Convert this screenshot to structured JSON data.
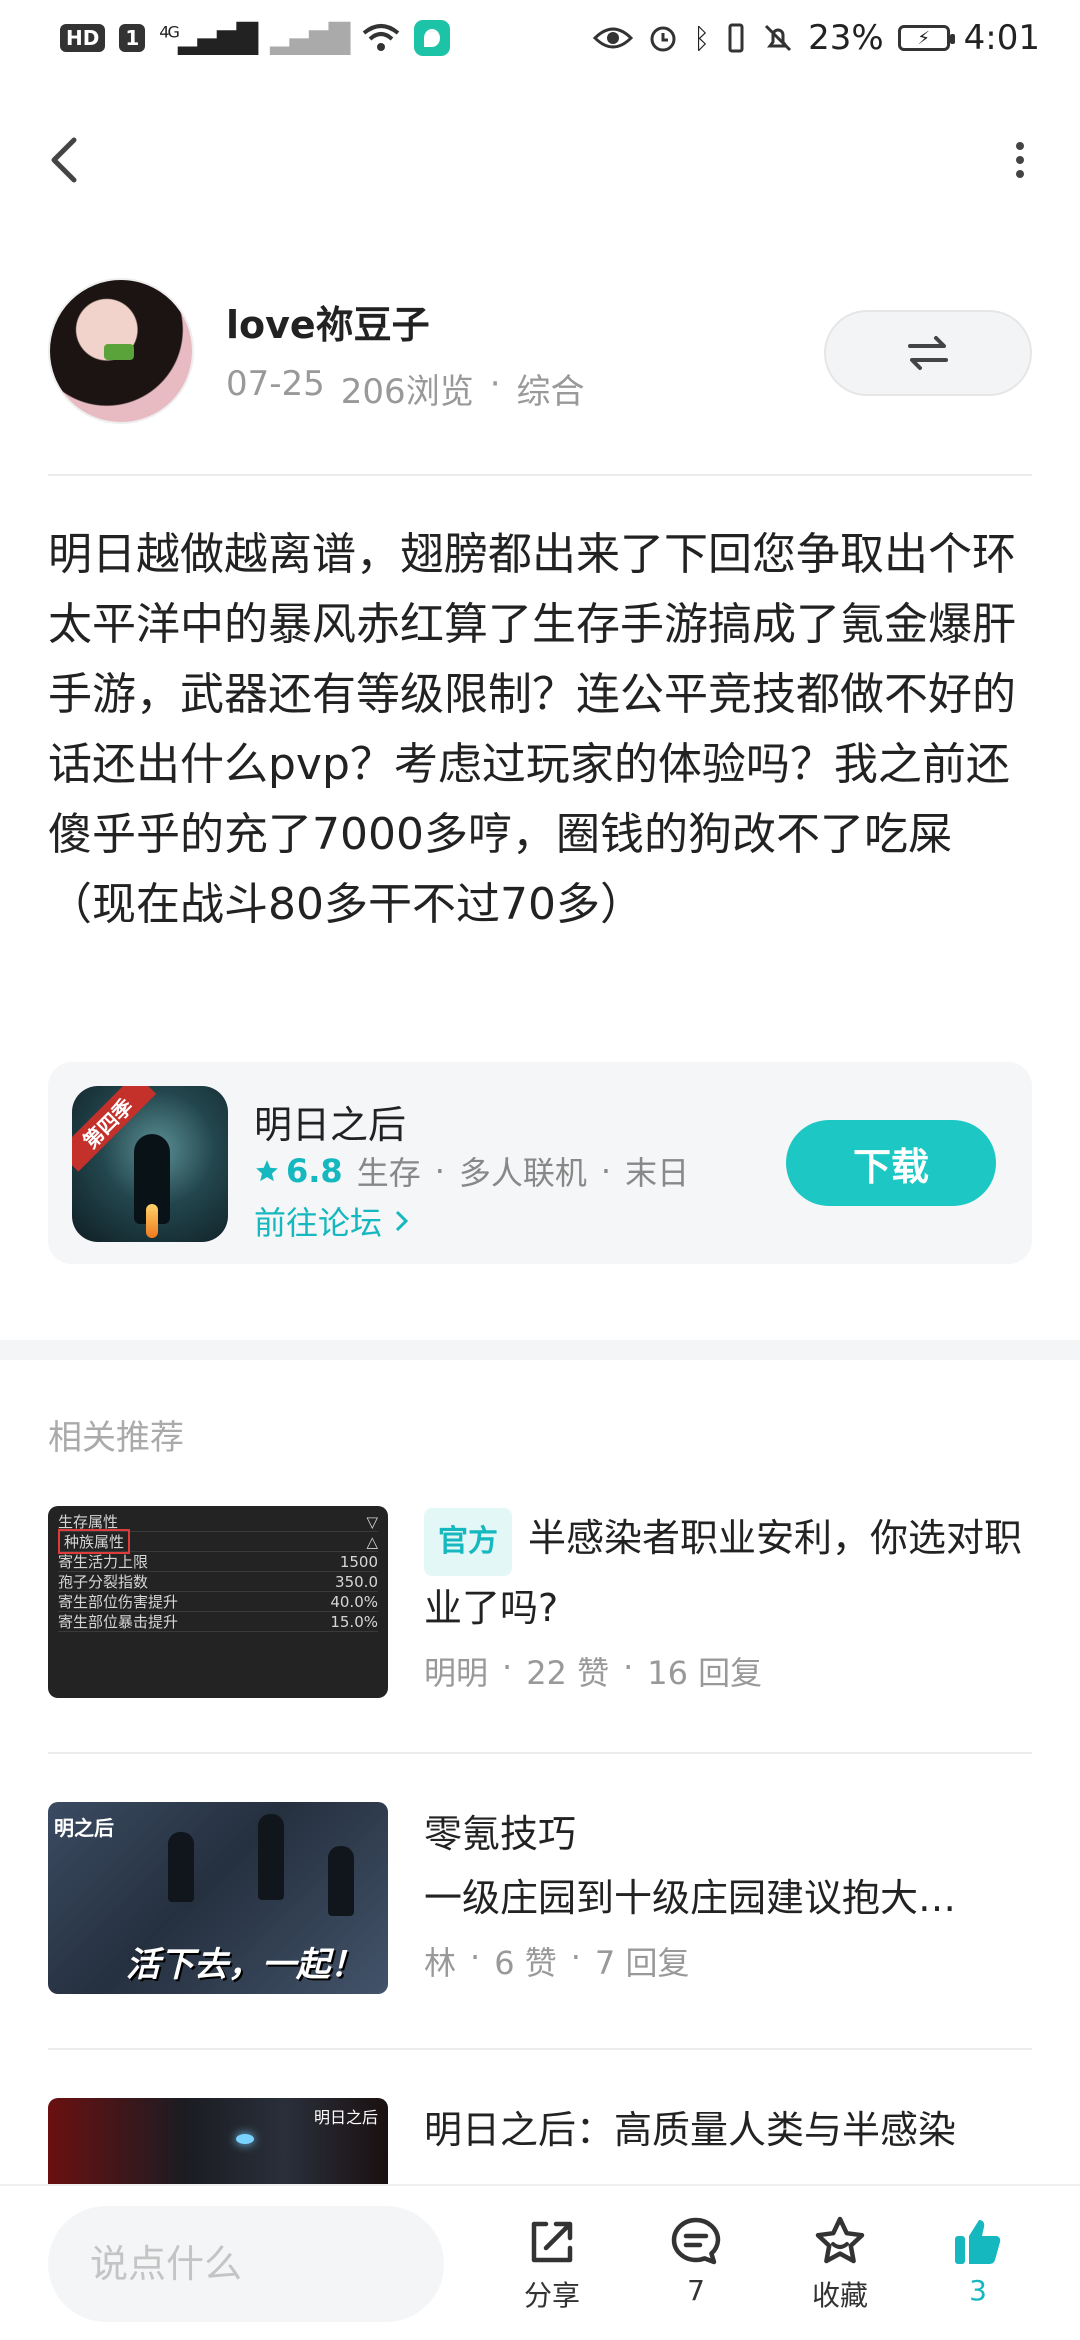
{
  "status_bar": {
    "left_badges": [
      "HD",
      "1",
      "4G"
    ],
    "battery_percent": "23%",
    "time": "4:01"
  },
  "author": {
    "name": "love祢豆子",
    "date": "07-25",
    "views": "206浏览",
    "separator": "·",
    "category": "综合"
  },
  "post": {
    "content": "明日越做越离谱，翅膀都出来了下回您争取出个环太平洋中的暴风赤红算了生存手游搞成了氪金爆肝手游，武器还有等级限制？连公平竞技都做不好的话还出什么pvp？考虑过玩家的体验吗？我之前还傻乎乎的充了7000多哼，圈钱的狗改不了吃屎（现在战斗80多干不过70多）"
  },
  "game_card": {
    "season_badge": "第四季",
    "title": "明日之后",
    "rating": "6.8",
    "tags": [
      "生存",
      "多人联机",
      "末日"
    ],
    "forum_link": "前往论坛",
    "download_label": "下载",
    "accent_color": "#1cc7c4"
  },
  "related": {
    "section_title": "相关推荐",
    "items": [
      {
        "badge": "官方",
        "title": "半感染者职业安利，你选对职业了吗?",
        "subtitle": "",
        "author": "明明",
        "likes": "22 赞",
        "replies": "16 回复",
        "thumb": {
          "header": "生存属性",
          "highlight": "种族属性",
          "rows": [
            {
              "label": "寄生活力上限",
              "value": "1500"
            },
            {
              "label": "孢子分裂指数",
              "value": "350.0"
            },
            {
              "label": "寄生部位伤害提升",
              "value": "40.0%"
            },
            {
              "label": "寄生部位暴击提升",
              "value": "15.0%"
            }
          ]
        }
      },
      {
        "badge": "",
        "title": "零氪技巧",
        "subtitle": "一级庄园到十级庄园建议抱大…",
        "author": "林",
        "likes": "6 赞",
        "replies": "7 回复",
        "thumb": {
          "logo": "明之后",
          "slogan": "活下去，一起！"
        }
      },
      {
        "badge": "",
        "title": "明日之后：高质量人类与半感染",
        "subtitle": "",
        "author": "",
        "likes": "",
        "replies": "",
        "thumb": {
          "logo": "明日之后"
        }
      }
    ]
  },
  "bottom_bar": {
    "comment_placeholder": "说点什么",
    "share_label": "分享",
    "comment_count": "7",
    "favorite_label": "收藏",
    "like_count": "3",
    "like_color": "#16b8bf"
  }
}
